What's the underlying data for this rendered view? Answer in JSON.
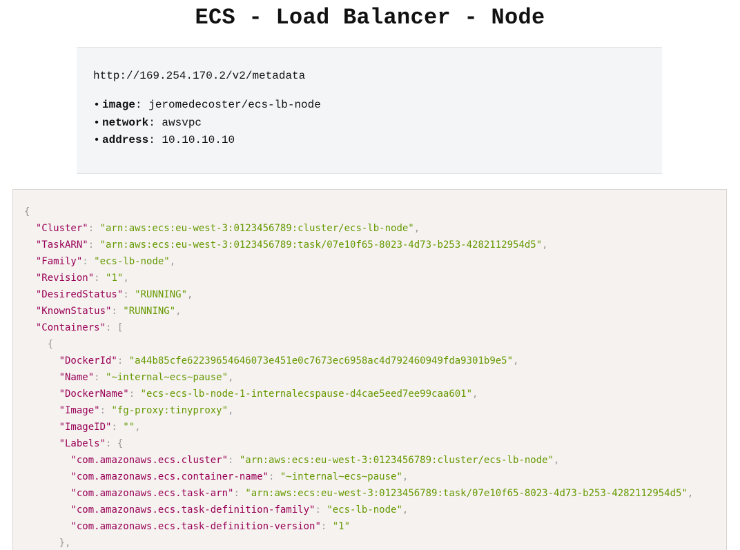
{
  "page": {
    "title": "ECS - Load Balancer - Node"
  },
  "info": {
    "url": "http://169.254.170.2/v2/metadata",
    "items": [
      {
        "key": "image",
        "value": "jeromedecoster/ecs-lb-node"
      },
      {
        "key": "network",
        "value": "awsvpc"
      },
      {
        "key": "address",
        "value": "10.10.10.10"
      }
    ]
  },
  "json_view": {
    "lines": [
      {
        "indent": 0,
        "open": "{"
      },
      {
        "indent": 1,
        "key": "\"Cluster\"",
        "value": "\"arn:aws:ecs:eu-west-3:0123456789:cluster/ecs-lb-node\"",
        "end": ","
      },
      {
        "indent": 1,
        "key": "\"TaskARN\"",
        "value": "\"arn:aws:ecs:eu-west-3:0123456789:task/07e10f65-8023-4d73-b253-4282112954d5\"",
        "end": ","
      },
      {
        "indent": 1,
        "key": "\"Family\"",
        "value": "\"ecs-lb-node\"",
        "end": ","
      },
      {
        "indent": 1,
        "key": "\"Revision\"",
        "value": "\"1\"",
        "end": ","
      },
      {
        "indent": 1,
        "key": "\"DesiredStatus\"",
        "value": "\"RUNNING\"",
        "end": ","
      },
      {
        "indent": 1,
        "key": "\"KnownStatus\"",
        "value": "\"RUNNING\"",
        "end": ","
      },
      {
        "indent": 1,
        "key": "\"Containers\"",
        "open": "["
      },
      {
        "indent": 2,
        "open": "{"
      },
      {
        "indent": 3,
        "key": "\"DockerId\"",
        "value": "\"a44b85cfe62239654646073e451e0c7673ec6958ac4d792460949fda9301b9e5\"",
        "end": ","
      },
      {
        "indent": 3,
        "key": "\"Name\"",
        "value": "\"~internal~ecs~pause\"",
        "end": ","
      },
      {
        "indent": 3,
        "key": "\"DockerName\"",
        "value": "\"ecs-ecs-lb-node-1-internalecspause-d4cae5eed7ee99caa601\"",
        "end": ","
      },
      {
        "indent": 3,
        "key": "\"Image\"",
        "value": "\"fg-proxy:tinyproxy\"",
        "end": ","
      },
      {
        "indent": 3,
        "key": "\"ImageID\"",
        "value": "\"\"",
        "end": ","
      },
      {
        "indent": 3,
        "key": "\"Labels\"",
        "open": "{"
      },
      {
        "indent": 4,
        "key": "\"com.amazonaws.ecs.cluster\"",
        "value": "\"arn:aws:ecs:eu-west-3:0123456789:cluster/ecs-lb-node\"",
        "end": ","
      },
      {
        "indent": 4,
        "key": "\"com.amazonaws.ecs.container-name\"",
        "value": "\"~internal~ecs~pause\"",
        "end": ","
      },
      {
        "indent": 4,
        "key": "\"com.amazonaws.ecs.task-arn\"",
        "value": "\"arn:aws:ecs:eu-west-3:0123456789:task/07e10f65-8023-4d73-b253-4282112954d5\"",
        "end": ","
      },
      {
        "indent": 4,
        "key": "\"com.amazonaws.ecs.task-definition-family\"",
        "value": "\"ecs-lb-node\"",
        "end": ","
      },
      {
        "indent": 4,
        "key": "\"com.amazonaws.ecs.task-definition-version\"",
        "value": "\"1\"",
        "end": ""
      },
      {
        "indent": 3,
        "open": "},"
      }
    ]
  },
  "colors": {
    "key": "#990055",
    "string": "#669900",
    "punctuation": "#999999",
    "code_background": "#f5f2f0",
    "info_background": "#f4f5f7"
  }
}
